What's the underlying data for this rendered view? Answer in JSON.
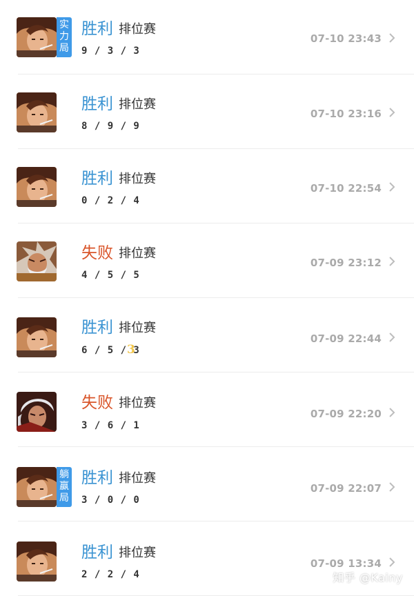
{
  "matches": [
    {
      "result": "胜利",
      "mode": "排位赛",
      "kda": "9 / 3 / 3",
      "time": "07-10 23:43",
      "tag": [
        "实",
        "力",
        "局"
      ],
      "mvp": ""
    },
    {
      "result": "胜利",
      "mode": "排位赛",
      "kda": "8 / 9 / 9",
      "time": "07-10 23:16",
      "tag": [],
      "mvp": ""
    },
    {
      "result": "胜利",
      "mode": "排位赛",
      "kda": "0 / 2 / 4",
      "time": "07-10 22:54",
      "tag": [],
      "mvp": ""
    },
    {
      "result": "失败",
      "mode": "排位赛",
      "kda": "4 / 5 / 5",
      "time": "07-09 23:12",
      "tag": [],
      "mvp": ""
    },
    {
      "result": "胜利",
      "mode": "排位赛",
      "kda": "6 / 5 / 3",
      "time": "07-09 22:44",
      "tag": [],
      "mvp": "3"
    },
    {
      "result": "失败",
      "mode": "排位赛",
      "kda": "3 / 6 / 1",
      "time": "07-09 22:20",
      "tag": [],
      "mvp": ""
    },
    {
      "result": "胜利",
      "mode": "排位赛",
      "kda": "3 / 0 / 0",
      "time": "07-09 22:07",
      "tag": [
        "躺",
        "赢",
        "局"
      ],
      "mvp": ""
    },
    {
      "result": "胜利",
      "mode": "排位赛",
      "kda": "2 / 2 / 4",
      "time": "07-09 13:34",
      "tag": [],
      "mvp": ""
    }
  ],
  "watermark": "知乎 @Kainy",
  "colors": {
    "win": "#3a93d2",
    "lose": "#d9552a",
    "tag_bg": "#3f9ae8",
    "time": "#aaaaaa"
  },
  "icons": {
    "row_chevron": "chevron-right-icon",
    "avatar_hero_a": "hero-brown-hair-portrait",
    "avatar_hero_b": "hero-white-beard-portrait",
    "avatar_hero_c": "hero-white-hair-portrait"
  }
}
